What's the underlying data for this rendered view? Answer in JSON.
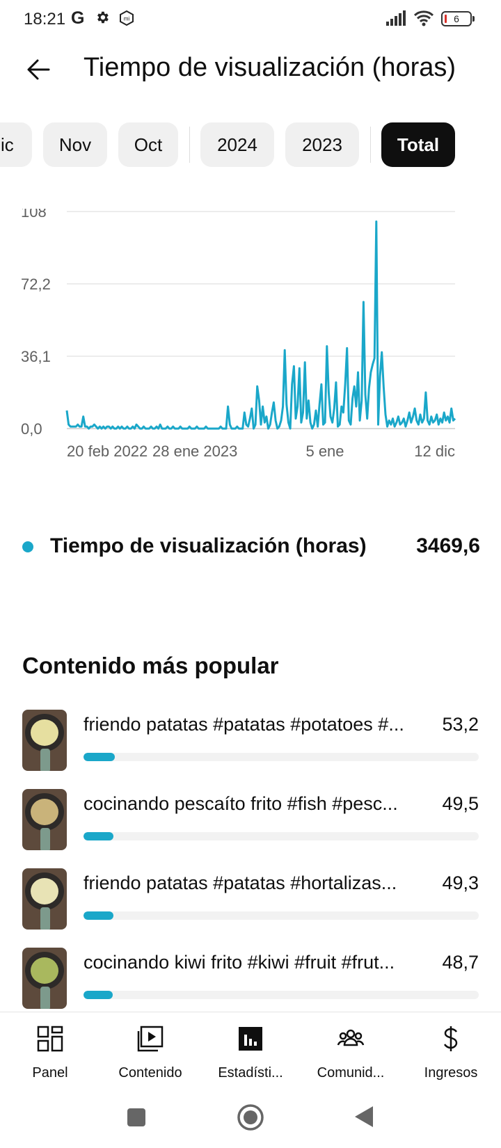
{
  "status_bar": {
    "time": "18:21",
    "g_label": "G",
    "battery": "6",
    "icons": [
      "gear-icon",
      "mi-icon",
      "signal-icon",
      "wifi-icon",
      "battery-icon"
    ]
  },
  "header": {
    "title": "Tiempo de visualización (horas)",
    "back_icon": "back-arrow-icon"
  },
  "filters": {
    "chips": [
      {
        "label": "Dic",
        "active": false
      },
      {
        "label": "Nov",
        "active": false
      },
      {
        "label": "Oct",
        "active": false
      },
      {
        "label": "2024",
        "active": false
      },
      {
        "label": "2023",
        "active": false
      },
      {
        "label": "Total",
        "active": true
      }
    ]
  },
  "chart_data": {
    "type": "line",
    "y_ticks": [
      "108",
      "72,2",
      "36,1",
      "0,0"
    ],
    "x_ticks": [
      "20 feb 2022",
      "28 ene 2023",
      "5 ene",
      "12 dic"
    ],
    "ylim": [
      0,
      108
    ],
    "grid": true,
    "color": "#1aa7c9",
    "series": [
      {
        "values": [
          9,
          2,
          1,
          1,
          1,
          1,
          2,
          1,
          1,
          6,
          1,
          1,
          0,
          1,
          1,
          2,
          1,
          0,
          1,
          0,
          1,
          0,
          1,
          1,
          0,
          1,
          0,
          0,
          1,
          0,
          1,
          0,
          0,
          1,
          0,
          0,
          1,
          0,
          2,
          1,
          0,
          0,
          1,
          0,
          0,
          0,
          1,
          0,
          0,
          1,
          0,
          2,
          0,
          0,
          0,
          1,
          0,
          0,
          1,
          0,
          0,
          0,
          1,
          0,
          0,
          0,
          0,
          1,
          0,
          0,
          0,
          1,
          0,
          0,
          0,
          0,
          1,
          0,
          0,
          0,
          0,
          0,
          0,
          0,
          1,
          0,
          0,
          0,
          11,
          2,
          0,
          0,
          0,
          1,
          0,
          0,
          0,
          8,
          2,
          1,
          5,
          10,
          0,
          2,
          21,
          14,
          2,
          11,
          3,
          6,
          0,
          2,
          8,
          13,
          4,
          0,
          1,
          4,
          11,
          39,
          12,
          3,
          0,
          22,
          31,
          5,
          11,
          30,
          3,
          8,
          33,
          5,
          14,
          3,
          0,
          2,
          9,
          1,
          12,
          22,
          2,
          3,
          41,
          18,
          6,
          3,
          10,
          23,
          1,
          2,
          11,
          8,
          22,
          40,
          4,
          2,
          15,
          21,
          11,
          28,
          4,
          14,
          63,
          17,
          5,
          20,
          28,
          32,
          35,
          103,
          2,
          26,
          38,
          21,
          7,
          1,
          4,
          2,
          5,
          1,
          3,
          6,
          2,
          3,
          5,
          1,
          4,
          8,
          3,
          6,
          10,
          4,
          2,
          7,
          3,
          5,
          18,
          4,
          2,
          6,
          3,
          4,
          7,
          2,
          5,
          3,
          8,
          4,
          6,
          3,
          10,
          4,
          5
        ]
      }
    ]
  },
  "legend": {
    "label": "Tiempo de visualización (horas)",
    "value": "3469,6",
    "color": "#1aa7c9"
  },
  "popular": {
    "title": "Contenido más popular",
    "items": [
      {
        "title": "friendo patatas #patatas #potatoes #...",
        "value": "53,2",
        "fraction": 0.08,
        "food_color": "#e6dfa0"
      },
      {
        "title": "cocinando pescaíto frito #fish #pesc...",
        "value": "49,5",
        "fraction": 0.075,
        "food_color": "#c9b37a"
      },
      {
        "title": "friendo patatas #patatas #hortalizas...",
        "value": "49,3",
        "fraction": 0.075,
        "food_color": "#e8e3b5"
      },
      {
        "title": "cocinando kiwi frito #kiwi #fruit #frut...",
        "value": "48,7",
        "fraction": 0.074,
        "food_color": "#a9b85e"
      }
    ]
  },
  "bottom_nav": {
    "items": [
      {
        "label": "Panel",
        "icon": "dashboard-icon"
      },
      {
        "label": "Contenido",
        "icon": "content-icon"
      },
      {
        "label": "Estadísti...",
        "icon": "analytics-icon"
      },
      {
        "label": "Comunid...",
        "icon": "community-icon"
      },
      {
        "label": "Ingresos",
        "icon": "dollar-icon"
      }
    ]
  },
  "system_nav": {
    "icons": [
      "recents-square-icon",
      "home-circle-icon",
      "back-triangle-icon"
    ]
  }
}
